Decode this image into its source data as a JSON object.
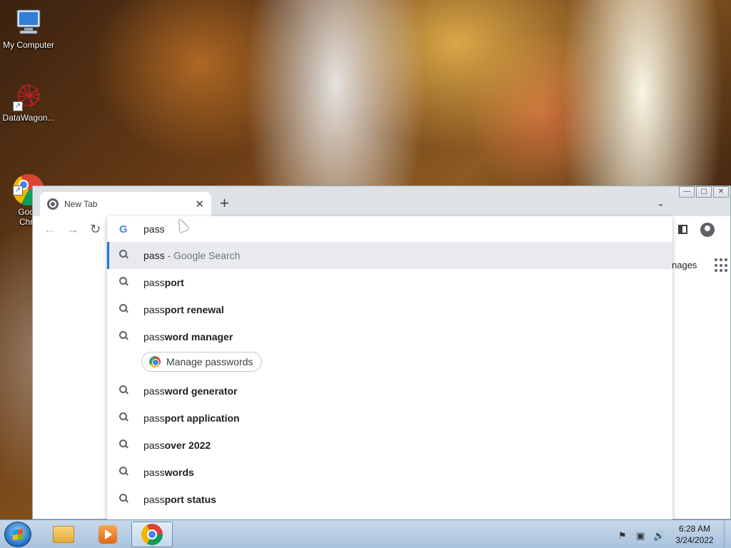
{
  "desktop": {
    "icons": [
      {
        "label": "My Computer"
      },
      {
        "label": "DataWagon..."
      },
      {
        "label": "Goog\nChro"
      }
    ]
  },
  "browser": {
    "tab": {
      "title": "New Tab",
      "close": "✕"
    },
    "new_tab": "+",
    "tab_list": "⌄",
    "window_controls": {
      "minimize": "—",
      "maximize": "▢",
      "close": "✕"
    },
    "nav": {
      "back": "←",
      "forward": "→",
      "reload": "↻",
      "menu": "⋮"
    },
    "ntp": {
      "images_link": "nages"
    },
    "omnibox": {
      "engine_icon": "G",
      "value": "pass",
      "suggestions": [
        {
          "typed": "pass",
          "rest": "",
          "suffix": " - Google Search",
          "selected": true
        },
        {
          "typed": "pass",
          "rest": "port"
        },
        {
          "typed": "pass",
          "rest": "port renewal"
        },
        {
          "typed": "pass",
          "rest": "word manager"
        },
        {
          "typed": "pass",
          "rest": "word generator"
        },
        {
          "typed": "pass",
          "rest": "port application"
        },
        {
          "typed": "pass",
          "rest": "over 2022"
        },
        {
          "typed": "pass",
          "rest": "words"
        },
        {
          "typed": "pass",
          "rest": "port status"
        }
      ],
      "action_chip": {
        "label": "Manage passwords"
      }
    }
  },
  "taskbar": {
    "clock_time": "6:28 AM",
    "clock_date": "3/24/2022"
  },
  "colors": {
    "accent": "#1a73e8",
    "selected_row": "#e8eaed",
    "tabstrip": "#dee1e6"
  },
  "icons": [
    "computer-icon",
    "datawagon-icon",
    "chrome-icon",
    "search-icon",
    "google-icon",
    "start-orb-icon",
    "folder-icon",
    "media-player-icon",
    "flag-icon",
    "network-icon",
    "volume-icon"
  ]
}
